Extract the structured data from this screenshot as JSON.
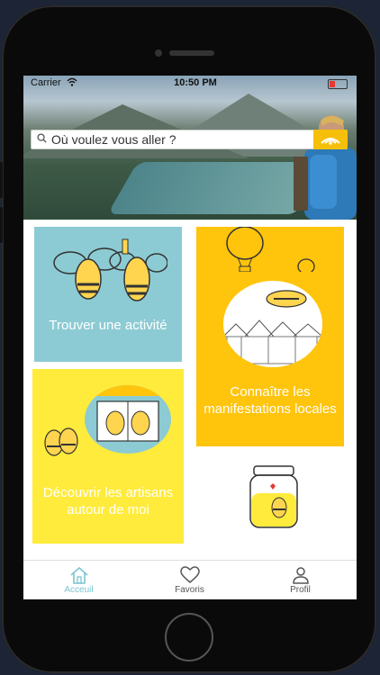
{
  "status_bar": {
    "carrier": "Carrier",
    "time": "10:50 PM"
  },
  "search": {
    "placeholder": "Où voulez vous aller ?"
  },
  "tiles": {
    "activity": "Trouver une activité",
    "events": "Connaître les manifestations locales",
    "artisans": "Découvrir les artisans autour de moi"
  },
  "tabbar": {
    "home": "Acceuil",
    "favorites": "Favoris",
    "profile": "Profil"
  },
  "colors": {
    "accent": "#ffc40c",
    "teal": "#8ccbd3",
    "light_yellow": "#ffeb3b",
    "active_tab": "#7cc5d0"
  },
  "icons": [
    "wifi-icon",
    "battery-icon",
    "search-icon",
    "go-icon",
    "bee-icon",
    "balloon-icon",
    "honey-jar-icon",
    "home-icon",
    "heart-icon",
    "profile-icon"
  ]
}
